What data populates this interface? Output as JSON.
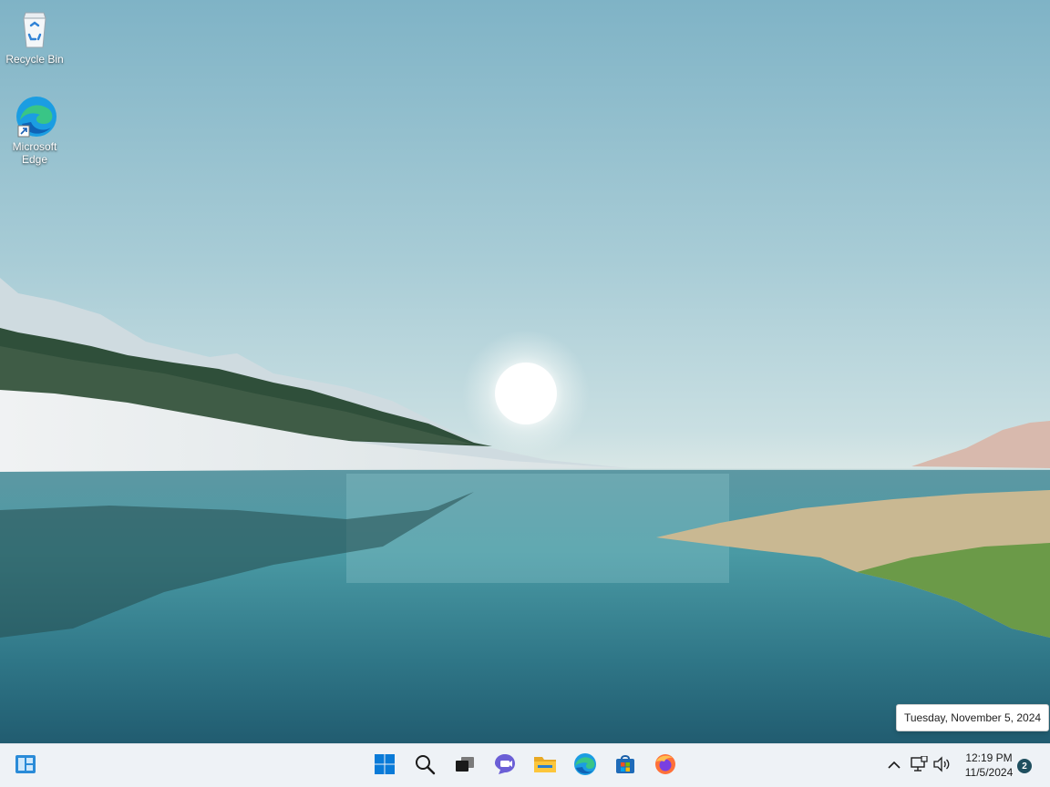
{
  "desktop": {
    "icons": [
      {
        "label": "Recycle Bin",
        "icon": "recycle-bin-icon"
      },
      {
        "label": "Microsoft Edge",
        "icon": "edge-icon"
      }
    ]
  },
  "tooltip": {
    "text": "Tuesday, November 5, 2024"
  },
  "taskbar": {
    "left": {
      "icon": "widgets-icon"
    },
    "center": [
      {
        "name": "start",
        "icon": "windows-logo-icon"
      },
      {
        "name": "search",
        "icon": "search-icon"
      },
      {
        "name": "task-view",
        "icon": "task-view-icon"
      },
      {
        "name": "chat",
        "icon": "teams-chat-icon"
      },
      {
        "name": "file-explorer",
        "icon": "folder-icon"
      },
      {
        "name": "edge",
        "icon": "edge-icon"
      },
      {
        "name": "store",
        "icon": "store-icon"
      },
      {
        "name": "firefox",
        "icon": "firefox-icon"
      }
    ],
    "tray": {
      "overflow_icon": "chevron-up-icon",
      "network_icon": "network-icon",
      "volume_icon": "volume-icon",
      "time": "12:19 PM",
      "date": "11/5/2024",
      "notification_count": "2"
    }
  },
  "colors": {
    "taskbar_bg": "#eef2f6",
    "windows_blue": "#0a7bd8",
    "badge": "#1f4f5f"
  }
}
